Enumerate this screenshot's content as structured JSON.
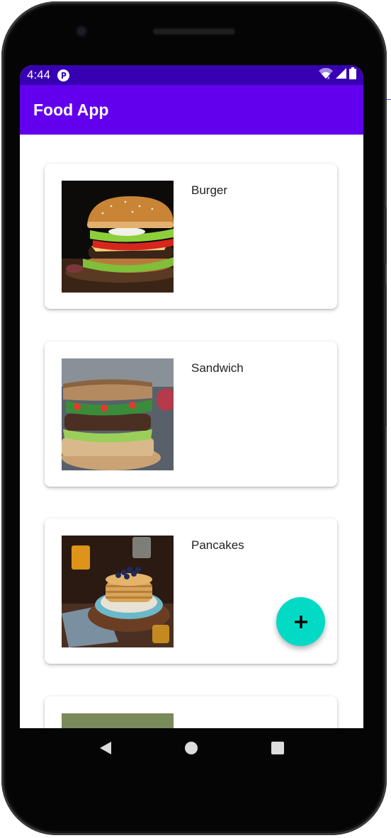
{
  "status_bar": {
    "time": "4:44",
    "icons": [
      "app-notification-icon",
      "wifi-icon",
      "signal-icon",
      "battery-icon"
    ]
  },
  "app_bar": {
    "title": "Food App"
  },
  "foods": [
    {
      "name": "Burger"
    },
    {
      "name": "Sandwich"
    },
    {
      "name": "Pancakes"
    },
    {
      "name": ""
    }
  ],
  "fab": {
    "icon": "plus-icon"
  },
  "nav_bar": {
    "icons": [
      "back-icon",
      "home-icon",
      "recents-icon"
    ]
  },
  "colors": {
    "status_bar": "#3700b3",
    "app_bar": "#6200ee",
    "fab": "#03dac5",
    "card": "#ffffff"
  }
}
